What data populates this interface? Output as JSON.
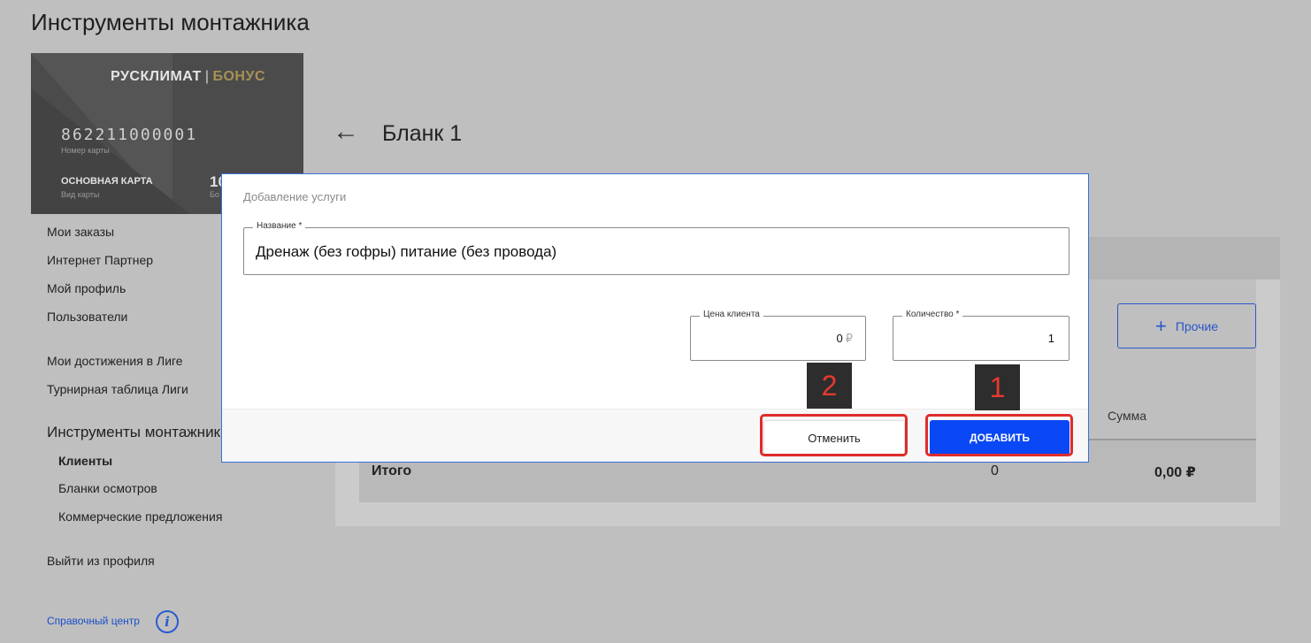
{
  "page": {
    "title": "Инструменты монтажника"
  },
  "card": {
    "brand": "РУСКЛИМАТ",
    "brand_separator": "|",
    "brand_bonus": "БОНУС",
    "number": "862211000001",
    "number_label": "Номер карты",
    "type": "ОСНОВНАЯ КАРТА",
    "type_label": "Вид карты",
    "balance": "10",
    "balance_label": "Бо"
  },
  "sidebar": {
    "items": [
      {
        "label": "Мои заказы"
      },
      {
        "label": "Интернет Партнер"
      },
      {
        "label": "Мой профиль"
      },
      {
        "label": "Пользователи"
      },
      {
        "label": "Мои достижения в Лиге"
      },
      {
        "label": "Турнирная таблица Лиги"
      }
    ],
    "section_title": "Инструменты монтажника",
    "subitems": [
      {
        "label": "Клиенты"
      },
      {
        "label": "Бланки осмотров"
      },
      {
        "label": "Коммерческие предложения"
      }
    ],
    "logout": "Выйти из профиля",
    "help": "Справочный центр"
  },
  "blank": {
    "title": "Бланк 1",
    "other_button": "Прочие",
    "column_sum": "Сумма",
    "total_label": "Итого",
    "total_qty": "0",
    "total_sum": "0,00 ₽"
  },
  "modal": {
    "title": "Добавление услуги",
    "name_label": "Название *",
    "name_value": "Дренаж (без гофры) питание (без провода)",
    "price_label": "Цена клиента",
    "price_value": "0",
    "price_currency": "₽",
    "qty_label": "Количество *",
    "qty_value": "1",
    "cancel_button": "Отменить",
    "add_button": "ДОБАВИТЬ"
  },
  "annotations": {
    "badge_1": "1",
    "badge_2": "2",
    "color": "#e02b2b"
  },
  "colors": {
    "accent": "#0a47f5",
    "link": "#1a4fc7",
    "overlay": "#bfbfbf"
  },
  "icons": {
    "back": "arrow-left-icon",
    "help": "info-icon",
    "plus": "plus-icon"
  }
}
